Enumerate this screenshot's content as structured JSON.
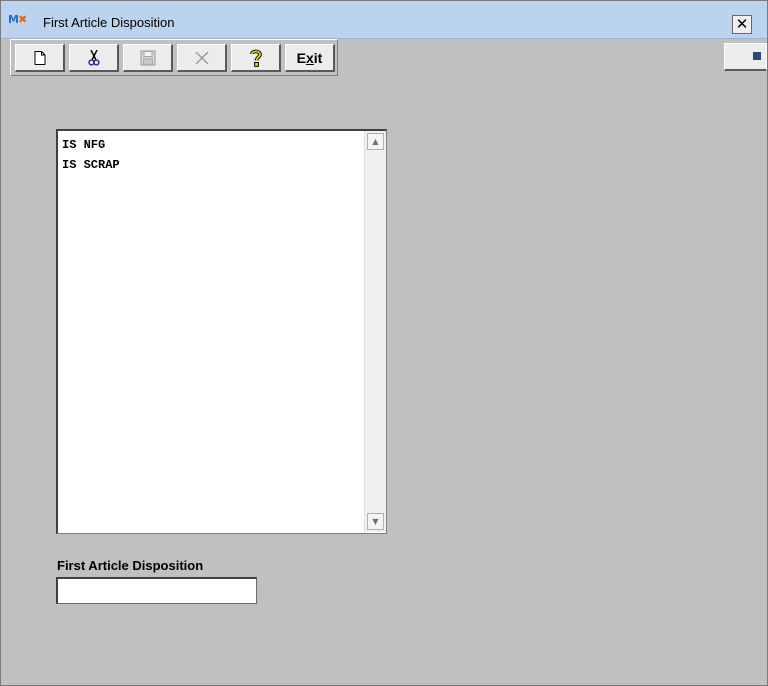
{
  "window": {
    "title": "First Article Disposition",
    "app_icon_text": "MX",
    "close_label": "✕"
  },
  "toolbar": {
    "buttons": [
      {
        "name": "new",
        "icon": "new-document-icon",
        "enabled": true
      },
      {
        "name": "cut",
        "icon": "scissors-icon",
        "enabled": true
      },
      {
        "name": "save",
        "icon": "floppy-disk-icon",
        "enabled": false
      },
      {
        "name": "delete",
        "icon": "x-delete-icon",
        "enabled": false
      },
      {
        "name": "help",
        "icon": "question-mark-icon",
        "enabled": true
      },
      {
        "name": "exit",
        "label_pre": "E",
        "label_underlined": "x",
        "label_post": "it",
        "enabled": true
      }
    ]
  },
  "list": {
    "items": [
      "IS NFG",
      "IS SCRAP"
    ]
  },
  "form": {
    "disposition_label": "First Article Disposition",
    "disposition_value": ""
  }
}
